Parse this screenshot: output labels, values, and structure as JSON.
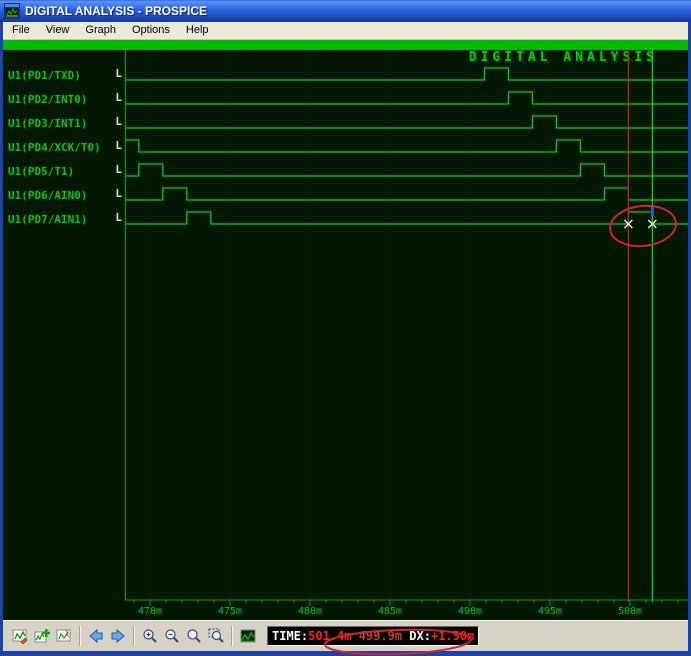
{
  "window": {
    "title": "DIGITAL ANALYSIS - PROSPICE"
  },
  "menu": {
    "items": [
      "File",
      "View",
      "Graph",
      "Options",
      "Help"
    ]
  },
  "graph": {
    "title": "DIGITAL ANALYSIS"
  },
  "chart_data": {
    "type": "digital-timing",
    "title": "DIGITAL ANALYSIS",
    "x_unit": "m",
    "x_ticks": [
      470,
      475,
      480,
      485,
      490,
      495,
      500
    ],
    "x_range": [
      468.44,
      503.69
    ],
    "signals": [
      {
        "name": "U1(PD1/TXD)",
        "level": "L",
        "high": [
          [
            490.9,
            492.4
          ]
        ]
      },
      {
        "name": "U1(PD2/INT0)",
        "level": "L",
        "high": [
          [
            492.4,
            493.9
          ]
        ]
      },
      {
        "name": "U1(PD3/INT1)",
        "level": "L",
        "high": [
          [
            493.9,
            495.4
          ]
        ]
      },
      {
        "name": "U1(PD4/XCK/T0)",
        "level": "L",
        "high": [
          [
            468.4,
            469.3
          ],
          [
            495.4,
            496.9
          ]
        ]
      },
      {
        "name": "U1(PD5/T1)",
        "level": "L",
        "high": [
          [
            469.3,
            470.8
          ],
          [
            496.9,
            498.4
          ]
        ]
      },
      {
        "name": "U1(PD6/AIN0)",
        "level": "L",
        "high": [
          [
            470.8,
            472.3
          ],
          [
            498.4,
            499.9
          ]
        ]
      },
      {
        "name": "U1(PD7/AIN1)",
        "level": "L",
        "high": [
          [
            472.3,
            473.8
          ],
          [
            499.9,
            501.4
          ]
        ]
      }
    ],
    "cursors": [
      {
        "color": "red",
        "time": 499.9,
        "hex": "#cc2211"
      },
      {
        "color": "green",
        "time": 501.4,
        "hex": "#00e000"
      }
    ],
    "cursor_marks": {
      "signal_index": 6
    }
  },
  "statusbar": {
    "segments": [
      {
        "text": "TIME:",
        "color": "#ffffff"
      },
      {
        "text": "501.4m",
        "color": "#ff2020"
      },
      {
        "text": " 499.9m",
        "color": "#c24024"
      },
      {
        "text": " DX:",
        "color": "#ffffff"
      },
      {
        "text": "+1.50m",
        "color": "#ff2020"
      }
    ]
  },
  "toolbar": {
    "buttons": [
      "edit-graph",
      "add-trace",
      "simulate-graph",
      "step-back",
      "step-forward",
      "zoom-in",
      "zoom-out",
      "zoom-full",
      "zoom-area",
      "view-graph"
    ]
  },
  "annotations": {
    "color": "#dd2222"
  }
}
